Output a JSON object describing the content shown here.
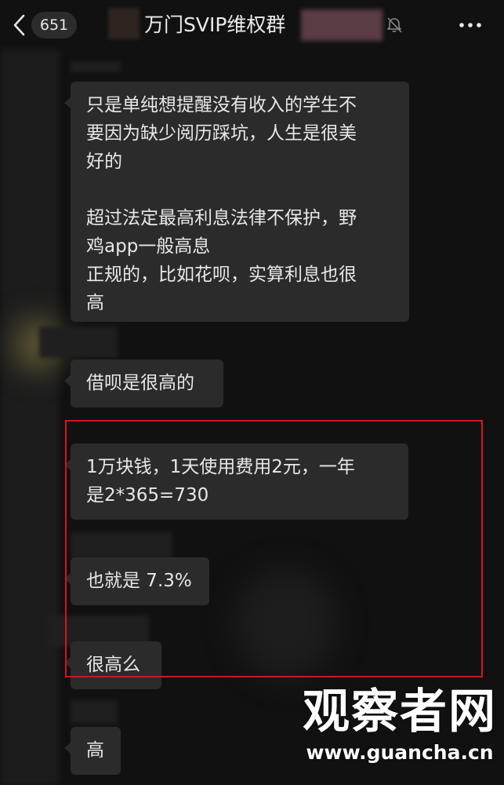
{
  "header": {
    "unread_count": "651",
    "title": "万门SVIP维权群",
    "icons": {
      "back": "chevron-left-icon",
      "mute": "bell-off-icon",
      "more": "more-dots-icon"
    }
  },
  "messages": [
    {
      "text": "只是单纯想提醒没有收入的学生不\n要因为缺少阅历踩坑，人生是很美\n好的\n\n超过法定最高利息法律不保护，野\n鸡app一般高息\n正规的，比如花呗，实算利息也很\n高"
    },
    {
      "text": "借呗是很高的"
    },
    {
      "text": "1万块钱，1天使用费用2元，一年\n是2*365=730"
    },
    {
      "text": "也就是 7.3%"
    },
    {
      "text": "很高么"
    },
    {
      "text": "高"
    }
  ],
  "colors": {
    "background": "#111111",
    "bubble": "#2b2b2b",
    "bubble_text": "#e8e8e8",
    "highlight_border": "#d4151c"
  },
  "watermark": {
    "logo": "观察者网",
    "url": "www.guancha.cn"
  }
}
